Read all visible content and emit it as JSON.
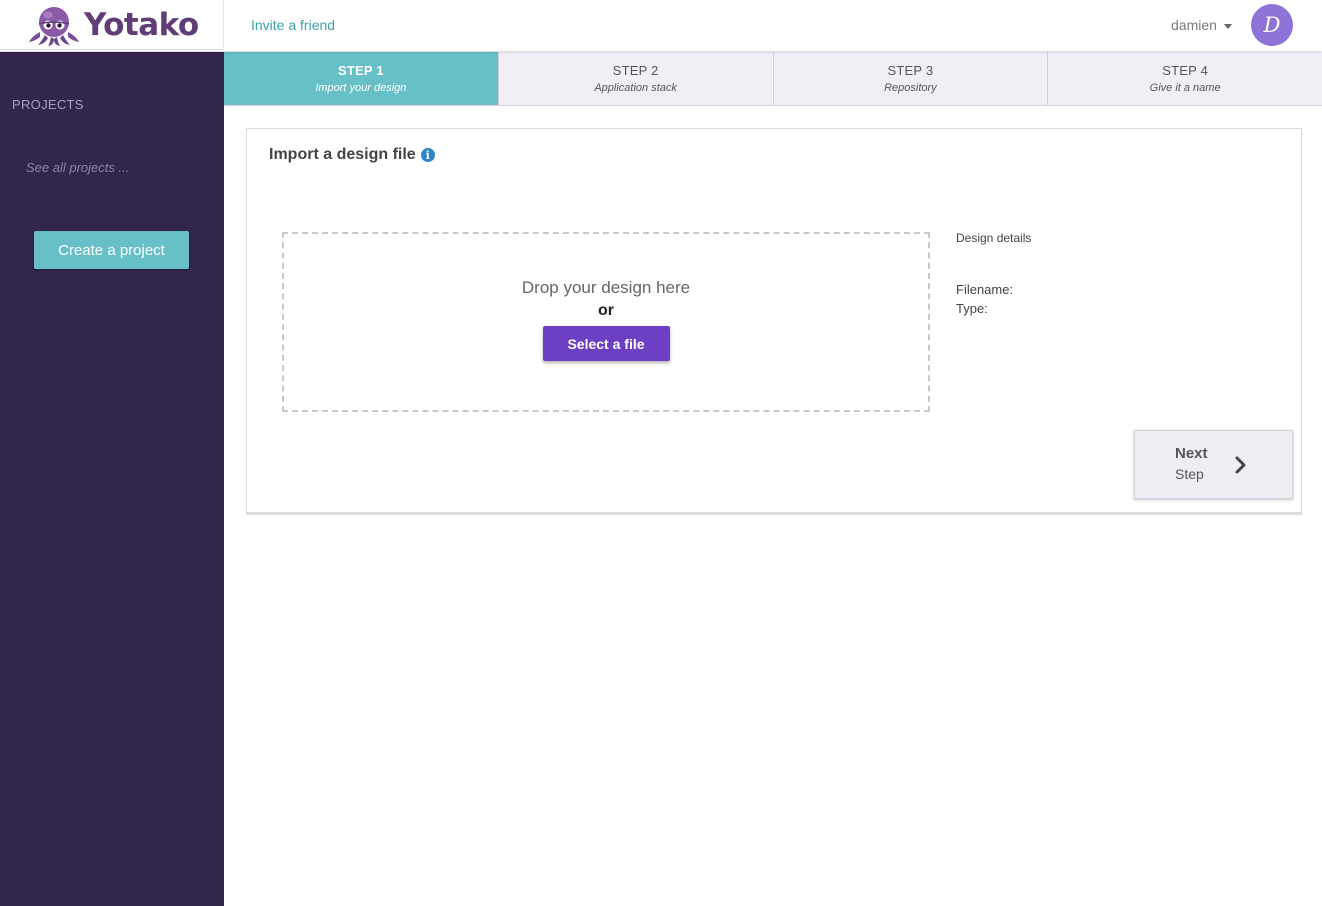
{
  "brand": {
    "name": "Yotako",
    "logo_icon": "octopus-logo",
    "color": "#5f3d77"
  },
  "topbar": {
    "invite_label": "Invite a friend",
    "username": "damien",
    "avatar_initial": "D"
  },
  "sidebar": {
    "projects_title": "PROJECTS",
    "see_all": "See all projects ...",
    "create_button": "Create a project"
  },
  "steps": [
    {
      "label": "STEP 1",
      "sub": "Import your design",
      "active": true
    },
    {
      "label": "STEP 2",
      "sub": "Application stack",
      "active": false
    },
    {
      "label": "STEP 3",
      "sub": "Repository",
      "active": false
    },
    {
      "label": "STEP 4",
      "sub": "Give it a name",
      "active": false
    }
  ],
  "card": {
    "title": "Import a design file",
    "info_icon": "info-icon",
    "dropzone": {
      "text": "Drop your design here",
      "or": "or",
      "select_button": "Select a file"
    },
    "details": {
      "title": "Design details",
      "filename_label": "Filename:",
      "type_label": "Type:"
    },
    "next_button": {
      "label": "Next",
      "sub": "Step",
      "icon": "chevron-right-icon"
    }
  },
  "colors": {
    "sidebar_bg": "#33264b",
    "accent_teal": "#67bfc7",
    "primary_purple": "#6c3fc3",
    "avatar_bg": "#8e73d9",
    "link": "#3aa1ad"
  }
}
